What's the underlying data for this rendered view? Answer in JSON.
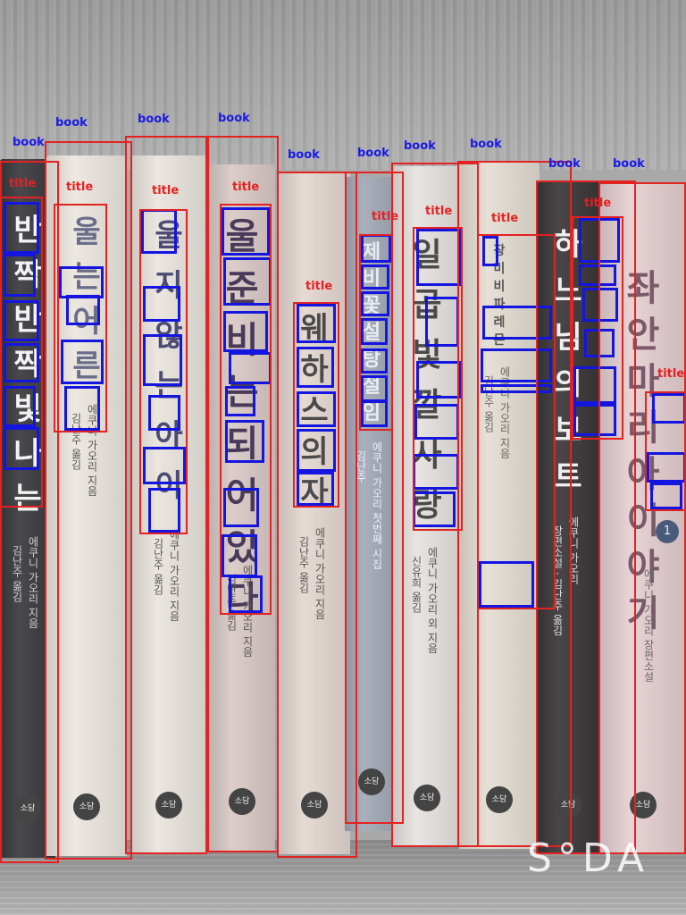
{
  "labels": {
    "book": "book",
    "title": "title"
  },
  "watermark": "S°DA",
  "books": [
    {
      "title": "반짝반짝 빛나는",
      "author": "에쿠니 가오리 지음",
      "translator": "김난주 옮김",
      "publisher": "소담"
    },
    {
      "title": "울는 어른",
      "author": "에쿠니 가오리 지음",
      "translator": "김난주 옮김",
      "publisher": "소담"
    },
    {
      "title": "울지 않는 아이",
      "author": "에쿠니 가오리 지음",
      "translator": "김난주 옮김",
      "publisher": "소담"
    },
    {
      "title": "울 준비는 되어 있다",
      "author": "에쿠니 가오리 지음",
      "translator": "김난주 옮김",
      "publisher": "소담"
    },
    {
      "title": "웨하스 의자",
      "author": "에쿠니 가오리 지음",
      "translator": "김난주 옮김",
      "publisher": "소담"
    },
    {
      "title": "제비꽃 설탕 절임",
      "author": "에쿠니 가오리 첫번째 시집",
      "translator": "김난주",
      "publisher": "소담"
    },
    {
      "title": "일곱 빛깔 사랑",
      "author": "에쿠니 가오리 외 지음",
      "translator": "신유희 옮김",
      "publisher": "소담"
    },
    {
      "title": "장미 비파 레몬",
      "author": "에쿠니 가오리 지음",
      "translator": "김난주 옮김",
      "publisher": "소담"
    },
    {
      "title": "하느님의 보트",
      "author": "에쿠니 가오리",
      "translator": "장편소설 · 김난주 옮김",
      "publisher": "소담"
    },
    {
      "title": "좌안 마리아 이야기",
      "author": "에쿠니 가오리 장편소설",
      "translator": "",
      "volume": "1",
      "publisher": "소담"
    }
  ]
}
